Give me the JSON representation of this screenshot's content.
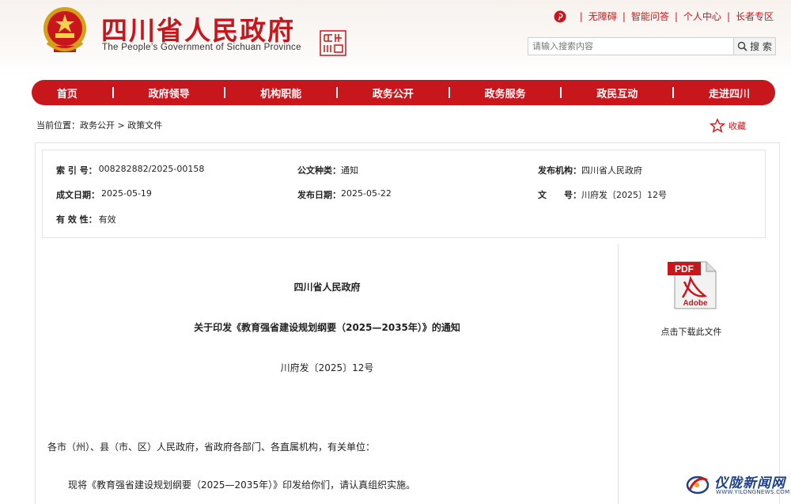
{
  "header": {
    "title": "四川省人民政府",
    "subtitle": "The People’s Government of Sichuan Province",
    "toplinks": [
      "无障碍",
      "智能问答",
      "个人中心",
      "长者专区"
    ],
    "search": {
      "placeholder": "请输入搜索内容",
      "button_label": "搜 索"
    }
  },
  "nav": {
    "items": [
      "首页",
      "政府领导",
      "机构职能",
      "政务公开",
      "政务服务",
      "政民互动",
      "走进四川"
    ]
  },
  "breadcrumb": "当前位置：政务公开 > 政策文件",
  "favorite_label": "收藏",
  "info": {
    "index_label": "索 引 号：",
    "index_value": "008282882/2025-00158",
    "category_label": "公文种类：",
    "category_value": "通知",
    "issuer_label": "发布机构：",
    "issuer_value": "四川省人民政府",
    "created_label": "成文日期：",
    "created_value": "2025-05-19",
    "published_label": "发布日期：",
    "published_value": "2025-05-22",
    "docno_label": "文　　号：",
    "docno_value": "川府发〔2025〕12号",
    "validity_label": "有 效 性：",
    "validity_value": "有效"
  },
  "document": {
    "org": "四川省人民政府",
    "title": "关于印发《教育强省建设规划纲要（2025—2035年）》的通知",
    "number": "川府发〔2025〕12号",
    "recipients": "各市（州）、县（市、区）人民政府，省政府各部门、各直属机构，有关单位：",
    "paragraph1": "现将《教育强省建设规划纲要（2025—2035年）》印发给你们，请认真组织实施。"
  },
  "download": {
    "icon_text_top": "PDF",
    "icon_text_bottom": "Adobe",
    "caption": "点击下载此文件"
  },
  "watermark": {
    "name": "仪陇新闻网",
    "url": "WWW.YILONGNEWS.COM"
  },
  "colors": {
    "brand_red": "#c8161d",
    "watermark_blue": "#1e3f8a"
  }
}
